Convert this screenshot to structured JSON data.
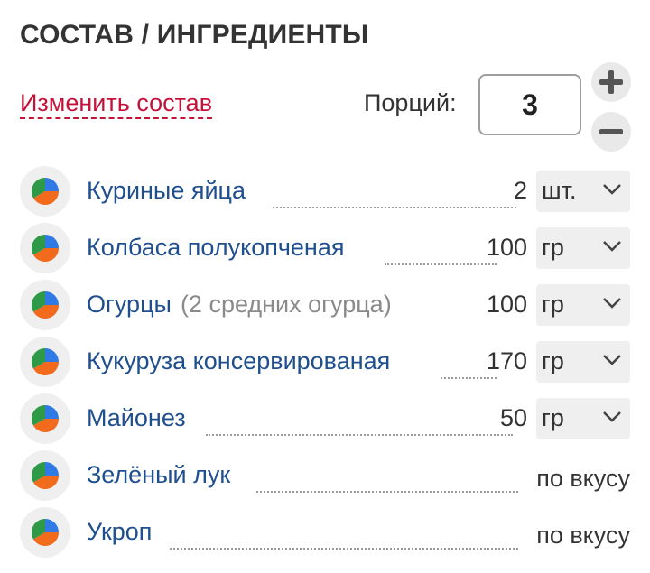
{
  "section": {
    "title": "СОСТАВ / ИНГРЕДИЕНТЫ",
    "edit_link": "Изменить состав"
  },
  "servings": {
    "label": "Порций:",
    "value": "3",
    "plus_icon": "plus-icon",
    "minus_icon": "minus-icon"
  },
  "colors": {
    "link": "#c41239",
    "ingredient_name": "#1f4f8e",
    "pie_green": "#2e9a47",
    "pie_blue": "#2f7ae5",
    "pie_orange": "#f26a1b"
  },
  "ingredients": [
    {
      "name": "Куриные яйца",
      "note": "",
      "amount": "2",
      "unit": "шт."
    },
    {
      "name": "Колбаса полукопченая",
      "note": "",
      "amount": "100",
      "unit": "гр"
    },
    {
      "name": "Огурцы",
      "note": "(2 средних огурца)",
      "amount": "100",
      "unit": "гр"
    },
    {
      "name": "Кукуруза консервированая",
      "note": "",
      "amount": "170",
      "unit": "гр"
    },
    {
      "name": "Майонез",
      "note": "",
      "amount": "50",
      "unit": "гр"
    },
    {
      "name": "Зелёный лук",
      "note": "",
      "amount": "",
      "unit": "",
      "to_taste": "по вкусу"
    },
    {
      "name": "Укроп",
      "note": "",
      "amount": "",
      "unit": "",
      "to_taste": "по вкусу"
    }
  ]
}
